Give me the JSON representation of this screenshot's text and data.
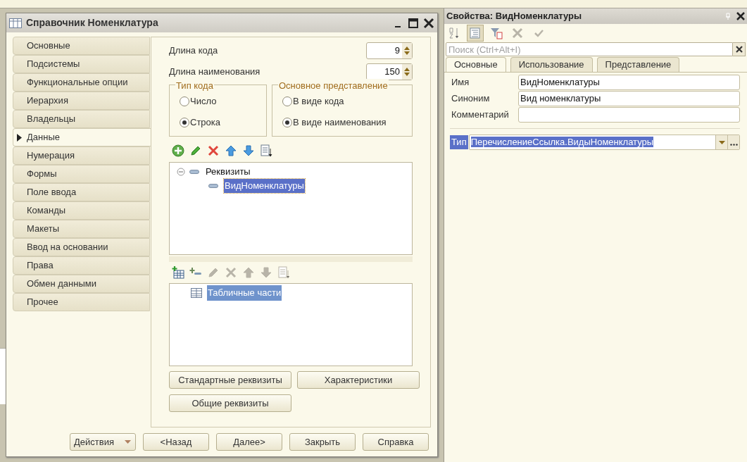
{
  "window": {
    "title": "Справочник Номенклатура"
  },
  "sidebar": {
    "items": [
      {
        "label": "Основные",
        "selected": false
      },
      {
        "label": "Подсистемы",
        "selected": false
      },
      {
        "label": "Функциональные опции",
        "selected": false
      },
      {
        "label": "Иерархия",
        "selected": false
      },
      {
        "label": "Владельцы",
        "selected": false
      },
      {
        "label": "Данные",
        "selected": true
      },
      {
        "label": "Нумерация",
        "selected": false
      },
      {
        "label": "Формы",
        "selected": false
      },
      {
        "label": "Поле ввода",
        "selected": false
      },
      {
        "label": "Команды",
        "selected": false
      },
      {
        "label": "Макеты",
        "selected": false
      },
      {
        "label": "Ввод на основании",
        "selected": false
      },
      {
        "label": "Права",
        "selected": false
      },
      {
        "label": "Обмен данными",
        "selected": false
      },
      {
        "label": "Прочее",
        "selected": false
      }
    ]
  },
  "spin_fields": [
    {
      "label": "Длина кода",
      "value": "9"
    },
    {
      "label": "Длина наименования",
      "value": "150"
    }
  ],
  "groups": [
    {
      "title": "Тип кода",
      "options": [
        {
          "label": "Число",
          "selected": false
        },
        {
          "label": "Строка",
          "selected": true
        }
      ]
    },
    {
      "title": "Основное представление",
      "options": [
        {
          "label": "В виде кода",
          "selected": false
        },
        {
          "label": "В виде наименования",
          "selected": true
        }
      ]
    }
  ],
  "attributes_toolbar": [
    {
      "kind": "add",
      "disabled": false
    },
    {
      "kind": "edit",
      "disabled": false
    },
    {
      "kind": "delete",
      "disabled": false
    },
    {
      "kind": "up",
      "disabled": false
    },
    {
      "kind": "down",
      "disabled": false
    },
    {
      "kind": "sort",
      "disabled": false
    }
  ],
  "attributes_tree": [
    {
      "label": "Реквизиты",
      "expanded": true,
      "selected": false,
      "children": [
        {
          "label": "ВидНоменклатуры",
          "selected": true
        }
      ]
    }
  ],
  "tables_toolbar": [
    {
      "kind": "add-table",
      "disabled": false
    },
    {
      "kind": "add-row",
      "disabled": false
    },
    {
      "kind": "edit",
      "disabled": true
    },
    {
      "kind": "delete",
      "disabled": true
    },
    {
      "kind": "up",
      "disabled": true
    },
    {
      "kind": "down",
      "disabled": true
    },
    {
      "kind": "sort",
      "disabled": true
    }
  ],
  "tables_tree": [
    {
      "label": "Табличные части",
      "selected": true
    }
  ],
  "content_buttons": [
    "Стандартные реквизиты",
    "Характеристики",
    "Общие реквизиты"
  ],
  "footer_buttons": [
    {
      "label": "Действия",
      "kind": "dropdown"
    },
    {
      "label": "<Назад",
      "kind": "plain"
    },
    {
      "label": "Далее>",
      "kind": "plain"
    },
    {
      "label": "Закрыть",
      "kind": "plain"
    },
    {
      "label": "Справка",
      "kind": "plain"
    }
  ],
  "properties": {
    "title": "Свойства: ВидНоменклатуры",
    "toolbar": [
      {
        "kind": "sort-az",
        "selected": false,
        "disabled": false
      },
      {
        "kind": "categories",
        "selected": true,
        "disabled": false
      },
      {
        "kind": "filter",
        "selected": false,
        "disabled": false
      },
      {
        "kind": "cancel",
        "selected": false,
        "disabled": true
      },
      {
        "kind": "apply",
        "selected": false,
        "disabled": true
      }
    ],
    "search": {
      "placeholder": "Поиск (Ctrl+Alt+I)"
    },
    "tabs": [
      {
        "label": "Основные",
        "selected": true
      },
      {
        "label": "Использование",
        "selected": false
      },
      {
        "label": "Представление",
        "selected": false
      }
    ],
    "fields": [
      {
        "label": "Имя",
        "value": "ВидНоменклатуры"
      },
      {
        "label": "Синоним",
        "value": "Вид номенклатуры"
      },
      {
        "label": "Комментарий"
      }
    ],
    "type": {
      "label": "Тип",
      "value": "ПеречислениеСсылка.ВидыНоменклатуры"
    }
  }
}
